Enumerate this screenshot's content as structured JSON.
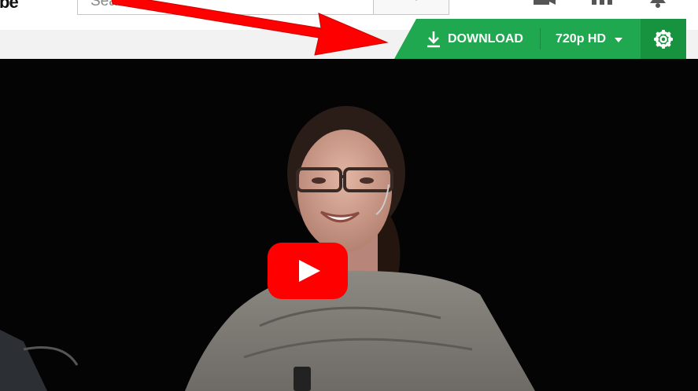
{
  "header": {
    "logo_fragment": "be",
    "search": {
      "placeholder": "Search"
    }
  },
  "downloader": {
    "download_label": "DOWNLOAD",
    "quality_label": "720p HD",
    "icons": [
      "download-icon",
      "caret-down-icon",
      "gear-icon"
    ]
  },
  "video": {
    "play_icon": "play-icon"
  },
  "colors": {
    "download_bar": "#1fa84f",
    "settings_bg": "#17923f",
    "play_red": "#ff0000",
    "arrow_red": "#ff0000"
  }
}
